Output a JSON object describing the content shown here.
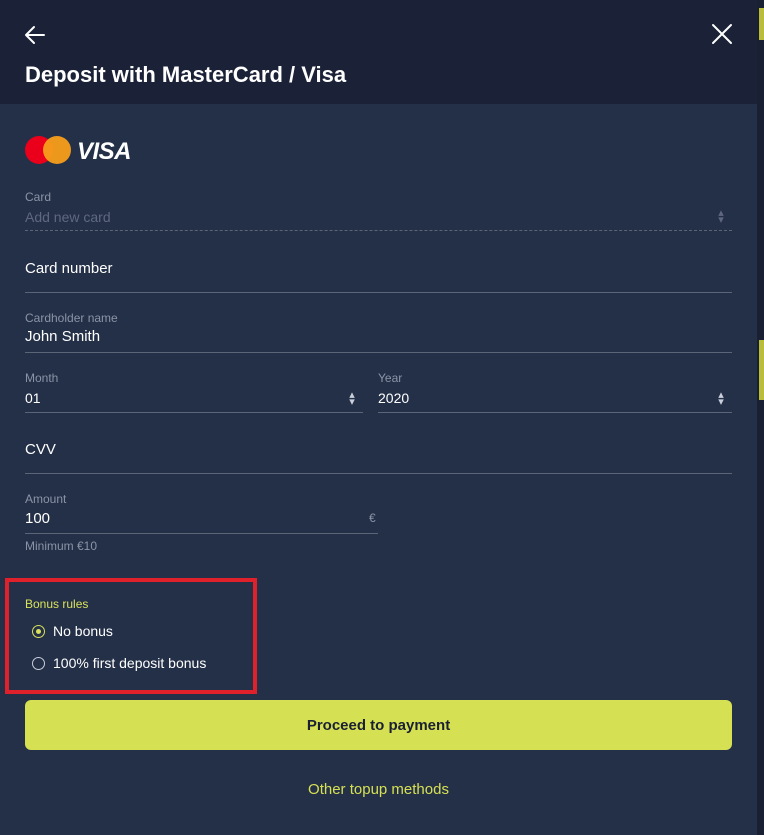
{
  "header": {
    "title": "Deposit with MasterCard / Visa",
    "back_icon": "arrow-left-icon",
    "close_icon": "close-icon"
  },
  "logos": {
    "mastercard_icon": "mastercard-logo",
    "visa_text": "VISA"
  },
  "form": {
    "card": {
      "label": "Card",
      "placeholder": "Add new card"
    },
    "card_number": {
      "placeholder": "Card number"
    },
    "cardholder": {
      "label": "Cardholder name",
      "value": "John Smith"
    },
    "month": {
      "label": "Month",
      "value": "01"
    },
    "year": {
      "label": "Year",
      "value": "2020"
    },
    "cvv": {
      "placeholder": "CVV"
    },
    "amount": {
      "label": "Amount",
      "value": "100",
      "currency": "€",
      "hint": "Minimum €10"
    }
  },
  "bonus": {
    "title": "Bonus rules",
    "options": [
      {
        "label": "No bonus",
        "checked": true
      },
      {
        "label": "100% first deposit bonus",
        "checked": false
      }
    ]
  },
  "actions": {
    "proceed_label": "Proceed to payment",
    "other_label": "Other topup methods"
  },
  "colors": {
    "background": "#243048",
    "header": "#1b2238",
    "accent": "#d6e053",
    "highlight_box": "#e0202a"
  }
}
